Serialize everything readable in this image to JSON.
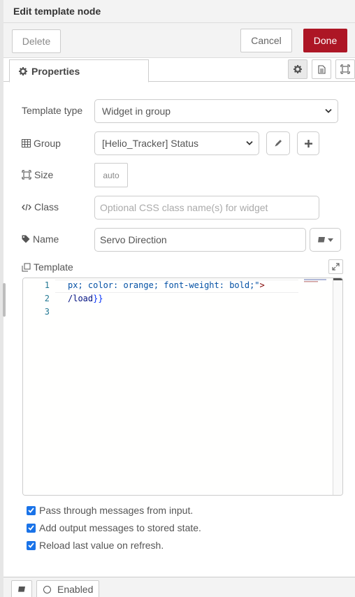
{
  "window": {
    "title": "Edit template node"
  },
  "actions": {
    "delete": "Delete",
    "cancel": "Cancel",
    "done": "Done"
  },
  "tabs": {
    "active_label": "Properties",
    "active_icon": "gear-icon",
    "side_icons": [
      "gear-icon",
      "document-icon",
      "frame-icon"
    ]
  },
  "form": {
    "template_type": {
      "label": "Template type",
      "value": "Widget in group"
    },
    "group": {
      "label": "Group",
      "value": "[Helio_Tracker] Status"
    },
    "size": {
      "label": "Size",
      "value": "auto"
    },
    "class": {
      "label": "Class",
      "placeholder": "Optional CSS class name(s) for widget"
    },
    "name": {
      "label": "Name",
      "value": "Servo Direction"
    },
    "template": {
      "label": "Template"
    }
  },
  "editor": {
    "line_numbers": [
      "1",
      "2",
      "3"
    ],
    "lines": {
      "l1_str": "px; color: orange; font-weight: bold;\"",
      "l1_tag": ">",
      "l2_var": "/load",
      "l2_brace": "}}"
    }
  },
  "options": {
    "passthru": {
      "label": "Pass through messages from input.",
      "checked": true
    },
    "store_state": {
      "label": "Add output messages to stored state.",
      "checked": true
    },
    "reload": {
      "label": "Reload last value on refresh.",
      "checked": true
    }
  },
  "footer": {
    "enabled_label": "Enabled"
  },
  "colors": {
    "done_button": "#ad1625",
    "checkbox": "#1a73e8"
  }
}
